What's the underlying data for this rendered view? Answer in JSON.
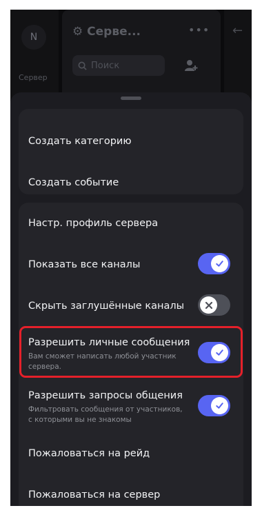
{
  "background": {
    "avatar_letter": "N",
    "rail_label": "Сервер",
    "server_title": "Серве...",
    "search_placeholder": "Поиск",
    "menu_dots": "•••"
  },
  "menu": {
    "card1": [
      {
        "label": "Создать категорию"
      },
      {
        "label": "Создать событие"
      }
    ],
    "card2": {
      "edit_profile": "Настр. профиль сервера",
      "show_all_channels": {
        "label": "Показать все каналы",
        "enabled": true
      },
      "hide_muted": {
        "label": "Скрыть заглушённые каналы",
        "enabled": false
      },
      "allow_dms": {
        "label": "Разрешить личные сообщения",
        "description": "Вам сможет написать любой участник сервера.",
        "enabled": true
      },
      "allow_requests": {
        "label": "Разрешить запросы общения",
        "description": "Фильтровать сообщения от участников, с которыми вы не знакомы",
        "enabled": true
      },
      "report_raid": "Пожаловаться на рейд",
      "report_server": "Пожаловаться на сервер"
    }
  },
  "colors": {
    "accent": "#5865f2",
    "highlight": "#e5202a",
    "sheet": "#1c1c21",
    "card": "#242429"
  }
}
